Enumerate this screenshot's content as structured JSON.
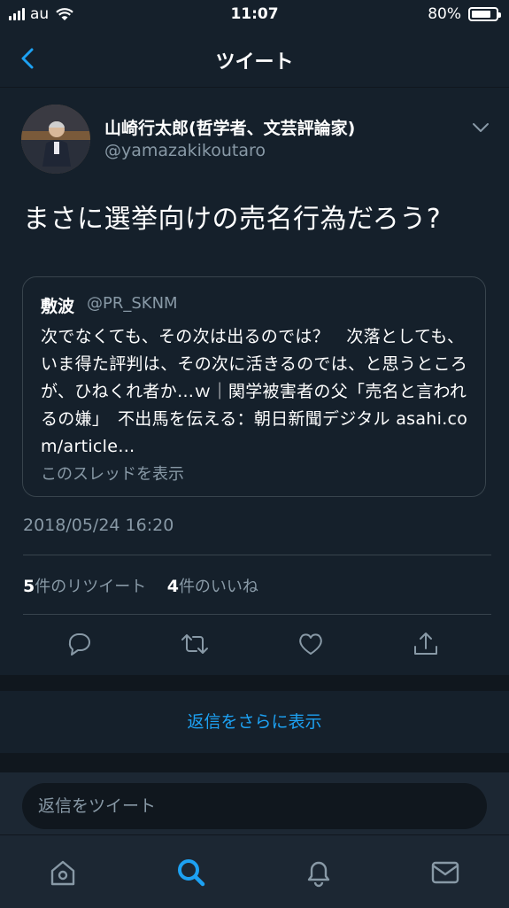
{
  "status_bar": {
    "carrier": "au",
    "time": "11:07",
    "battery": "80%",
    "battery_level": 0.8
  },
  "nav": {
    "title": "ツイート",
    "back_icon": "chevron-left-icon"
  },
  "tweet": {
    "display_name": "山崎行太郎(哲学者、文芸評論家)",
    "handle": "@yamazakikoutaro",
    "text": "まさに選挙向けの売名行為だろう?",
    "quoted": {
      "name": "敷波",
      "handle": "@PR_SKNM",
      "text": "次でなくても、その次は出るのでは？　次落としても、いま得た評判は、その次に活きるのでは、と思うところが、ひねくれ者か…ｗ｜関学被害者の父「売名と言われるの嫌」　不出馬を伝える：朝日新聞デジタル asahi.com/article…",
      "thread_link": "このスレッドを表示"
    },
    "timestamp": "2018/05/24 16:20",
    "retweet_count": "5",
    "retweet_label": "件のリツイート",
    "like_count": "4",
    "like_label": "件のいいね"
  },
  "more_replies": "返信をさらに表示",
  "compose": {
    "placeholder": "返信をツイート"
  },
  "tabs": [
    "home-icon",
    "search-icon",
    "notifications-icon",
    "messages-icon"
  ],
  "colors": {
    "background": "#15202b",
    "accent": "#1da1f2",
    "secondary_text": "#8899a6",
    "border": "#38444d"
  }
}
